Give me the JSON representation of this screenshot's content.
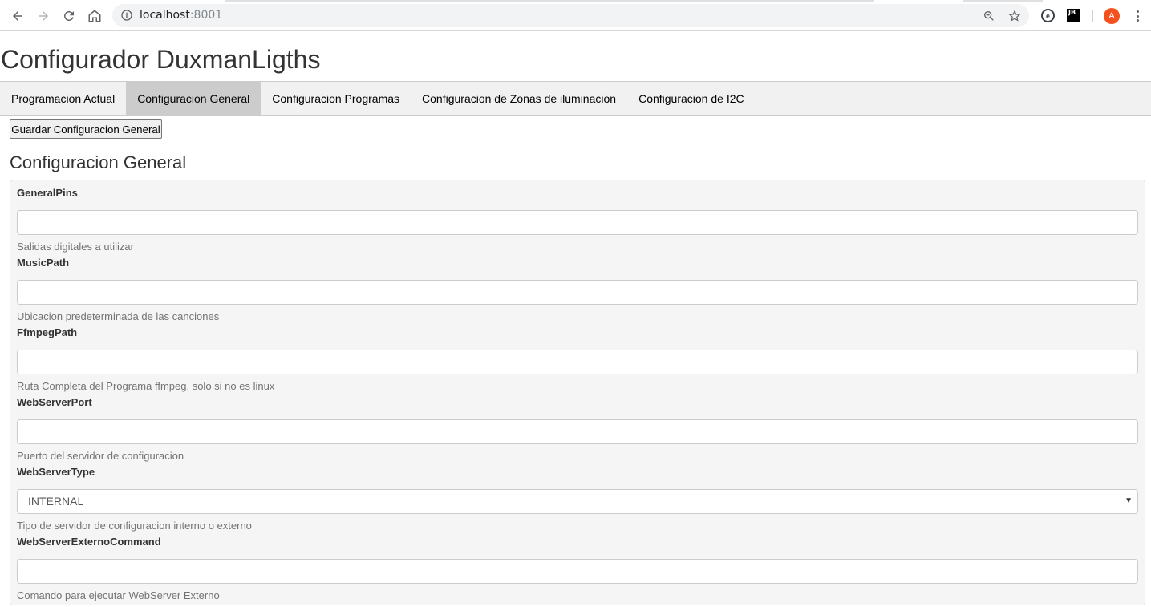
{
  "browser": {
    "url_host": "localhost",
    "url_port": ":8001",
    "avatar_letter": "A",
    "extension_jb_label": "JB",
    "extension_e_label": "e"
  },
  "page": {
    "title": "Configurador DuxmanLigths"
  },
  "tabs": [
    {
      "label": "Programacion Actual",
      "active": false
    },
    {
      "label": "Configuracion General",
      "active": true
    },
    {
      "label": "Configuracion Programas",
      "active": false
    },
    {
      "label": "Configuracion de Zonas de iluminacion",
      "active": false
    },
    {
      "label": "Configuracion de I2C",
      "active": false
    }
  ],
  "toolbar": {
    "save_label": "Guardar Configuracion General"
  },
  "section": {
    "title": "Configuracion General"
  },
  "fields": [
    {
      "label": "GeneralPins",
      "value": "",
      "help": "Salidas digitales a utilizar",
      "type": "text"
    },
    {
      "label": "MusicPath",
      "value": "",
      "help": "Ubicacion predeterminada de las canciones",
      "type": "text"
    },
    {
      "label": "FfmpegPath",
      "value": "",
      "help": "Ruta Completa del Programa ffmpeg, solo si no es linux",
      "type": "text"
    },
    {
      "label": "WebServerPort",
      "value": "",
      "help": "Puerto del servidor de configuracion",
      "type": "text"
    },
    {
      "label": "WebServerType",
      "value": "INTERNAL",
      "help": "Tipo de servidor de configuracion interno o externo",
      "type": "select"
    },
    {
      "label": "WebServerExternoCommand",
      "value": "",
      "help": "Comando para ejecutar WebServer Externo",
      "type": "text"
    }
  ],
  "colors": {
    "active_tab": "#cccccc",
    "tab_bar": "#f1f1f1",
    "panel_bg": "#f5f5f5",
    "avatar": "#f4511e"
  }
}
